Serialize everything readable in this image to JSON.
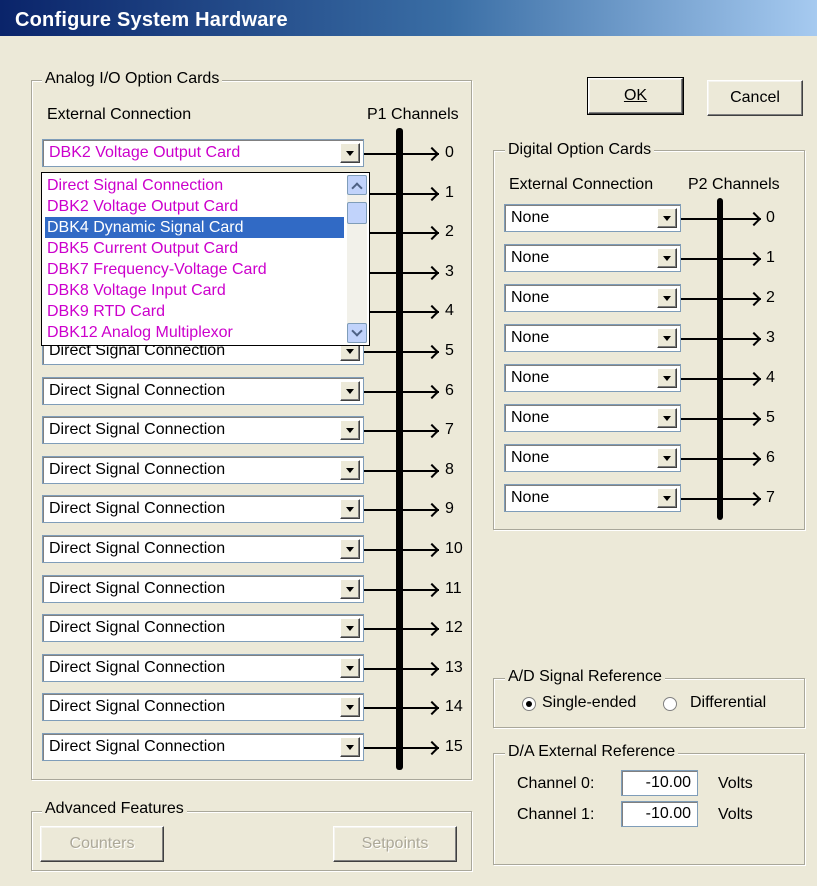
{
  "window": {
    "title": "Configure System Hardware"
  },
  "buttons": {
    "ok": "OK",
    "cancel": "Cancel",
    "counters": "Counters",
    "setpoints": "Setpoints"
  },
  "analog": {
    "group_label": "Analog I/O Option Cards",
    "col_external": "External Connection",
    "col_channels": "P1 Channels",
    "rows": [
      {
        "value": "DBK2 Voltage Output Card",
        "channel": "0"
      },
      {
        "value": "",
        "channel": "1"
      },
      {
        "value": "",
        "channel": "2"
      },
      {
        "value": "",
        "channel": "3"
      },
      {
        "value": "",
        "channel": "4"
      },
      {
        "value": "Direct Signal Connection",
        "channel": "5"
      },
      {
        "value": "Direct Signal Connection",
        "channel": "6"
      },
      {
        "value": "Direct Signal Connection",
        "channel": "7"
      },
      {
        "value": "Direct Signal Connection",
        "channel": "8"
      },
      {
        "value": "Direct Signal Connection",
        "channel": "9"
      },
      {
        "value": "Direct Signal Connection",
        "channel": "10"
      },
      {
        "value": "Direct Signal Connection",
        "channel": "11"
      },
      {
        "value": "Direct Signal Connection",
        "channel": "12"
      },
      {
        "value": "Direct Signal Connection",
        "channel": "13"
      },
      {
        "value": "Direct Signal Connection",
        "channel": "14"
      },
      {
        "value": "Direct Signal Connection",
        "channel": "15"
      }
    ],
    "dropdown_options": [
      "Direct Signal Connection",
      "DBK2 Voltage Output Card",
      "DBK4 Dynamic Signal Card",
      "DBK5 Current Output Card",
      "DBK7 Frequency-Voltage Card",
      "DBK8 Voltage Input Card",
      "DBK9 RTD Card",
      "DBK12 Analog Multiplexor"
    ],
    "dropdown_selected": "DBK4 Dynamic Signal Card"
  },
  "digital": {
    "group_label": "Digital Option Cards",
    "col_external": "External Connection",
    "col_channels": "P2 Channels",
    "rows": [
      {
        "value": "None",
        "channel": "0"
      },
      {
        "value": "None",
        "channel": "1"
      },
      {
        "value": "None",
        "channel": "2"
      },
      {
        "value": "None",
        "channel": "3"
      },
      {
        "value": "None",
        "channel": "4"
      },
      {
        "value": "None",
        "channel": "5"
      },
      {
        "value": "None",
        "channel": "6"
      },
      {
        "value": "None",
        "channel": "7"
      }
    ]
  },
  "ad_reference": {
    "group_label": "A/D Signal Reference",
    "single_ended": "Single-ended",
    "differential": "Differential",
    "selected": "Single-ended"
  },
  "da_reference": {
    "group_label": "D/A External Reference",
    "ch0_label": "Channel 0:",
    "ch0_value": "-10.00",
    "ch1_label": "Channel 1:",
    "ch1_value": "-10.00",
    "unit": "Volts"
  },
  "advanced": {
    "group_label": "Advanced Features"
  },
  "colors": {
    "card_text": "#cc00cc",
    "selection": "#316ac5",
    "title_bar": "#0a246a"
  }
}
